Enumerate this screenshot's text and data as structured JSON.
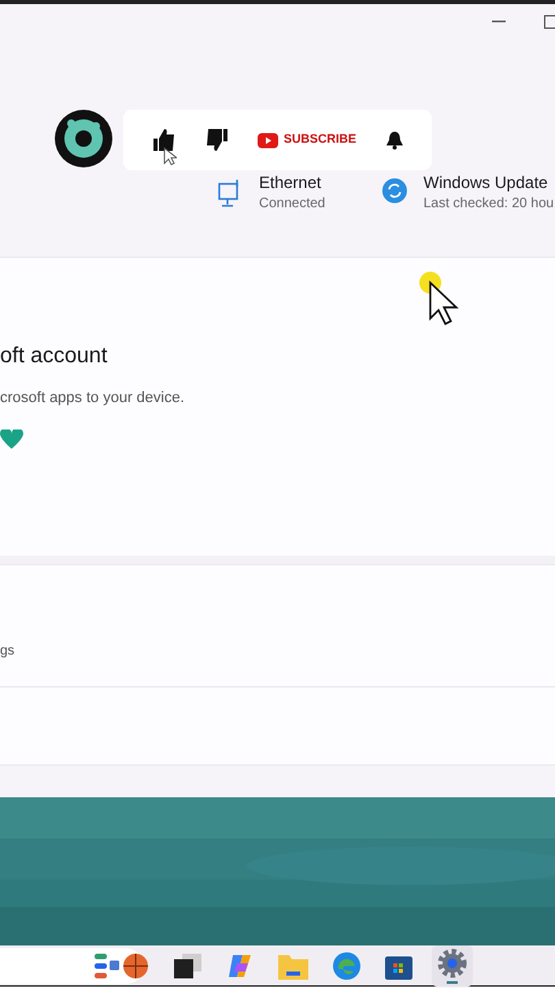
{
  "overlay": {
    "subscribe": "SUBSCRIBE"
  },
  "status": [
    {
      "kind": "ethernet",
      "title": "Ethernet",
      "subtitle": "Connected"
    },
    {
      "kind": "update",
      "title": "Windows Update",
      "subtitle": "Last checked: 20 hou"
    }
  ],
  "account_card": {
    "title": "oft account",
    "description": "crosoft apps to your device."
  },
  "settings_row": {
    "label": "gs"
  },
  "taskbar": {
    "apps": [
      {
        "kind": "widgets"
      },
      {
        "kind": "taskview"
      },
      {
        "kind": "copilot"
      },
      {
        "kind": "folder"
      },
      {
        "kind": "edge"
      },
      {
        "kind": "store"
      },
      {
        "kind": "settings",
        "selected": true
      }
    ]
  }
}
